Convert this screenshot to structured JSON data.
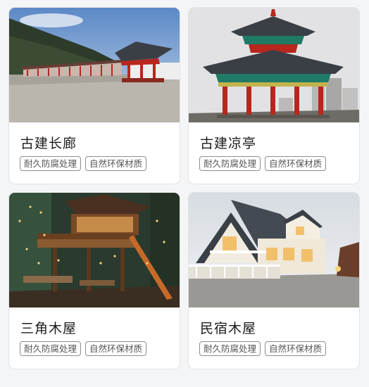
{
  "cards": [
    {
      "title": "古建长廊",
      "tags": [
        "耐久防腐处理",
        "自然环保材质"
      ]
    },
    {
      "title": "古建凉亭",
      "tags": [
        "耐久防腐处理",
        "自然环保材质"
      ]
    },
    {
      "title": "三角木屋",
      "tags": [
        "耐久防腐处理",
        "自然环保材质"
      ]
    },
    {
      "title": "民宿木屋",
      "tags": [
        "耐久防腐处理",
        "自然环保材质"
      ]
    }
  ],
  "colors": {
    "accent_red": "#b8261e",
    "roof_dark": "#3a3f46",
    "tag_border": "#8d8d8d"
  }
}
